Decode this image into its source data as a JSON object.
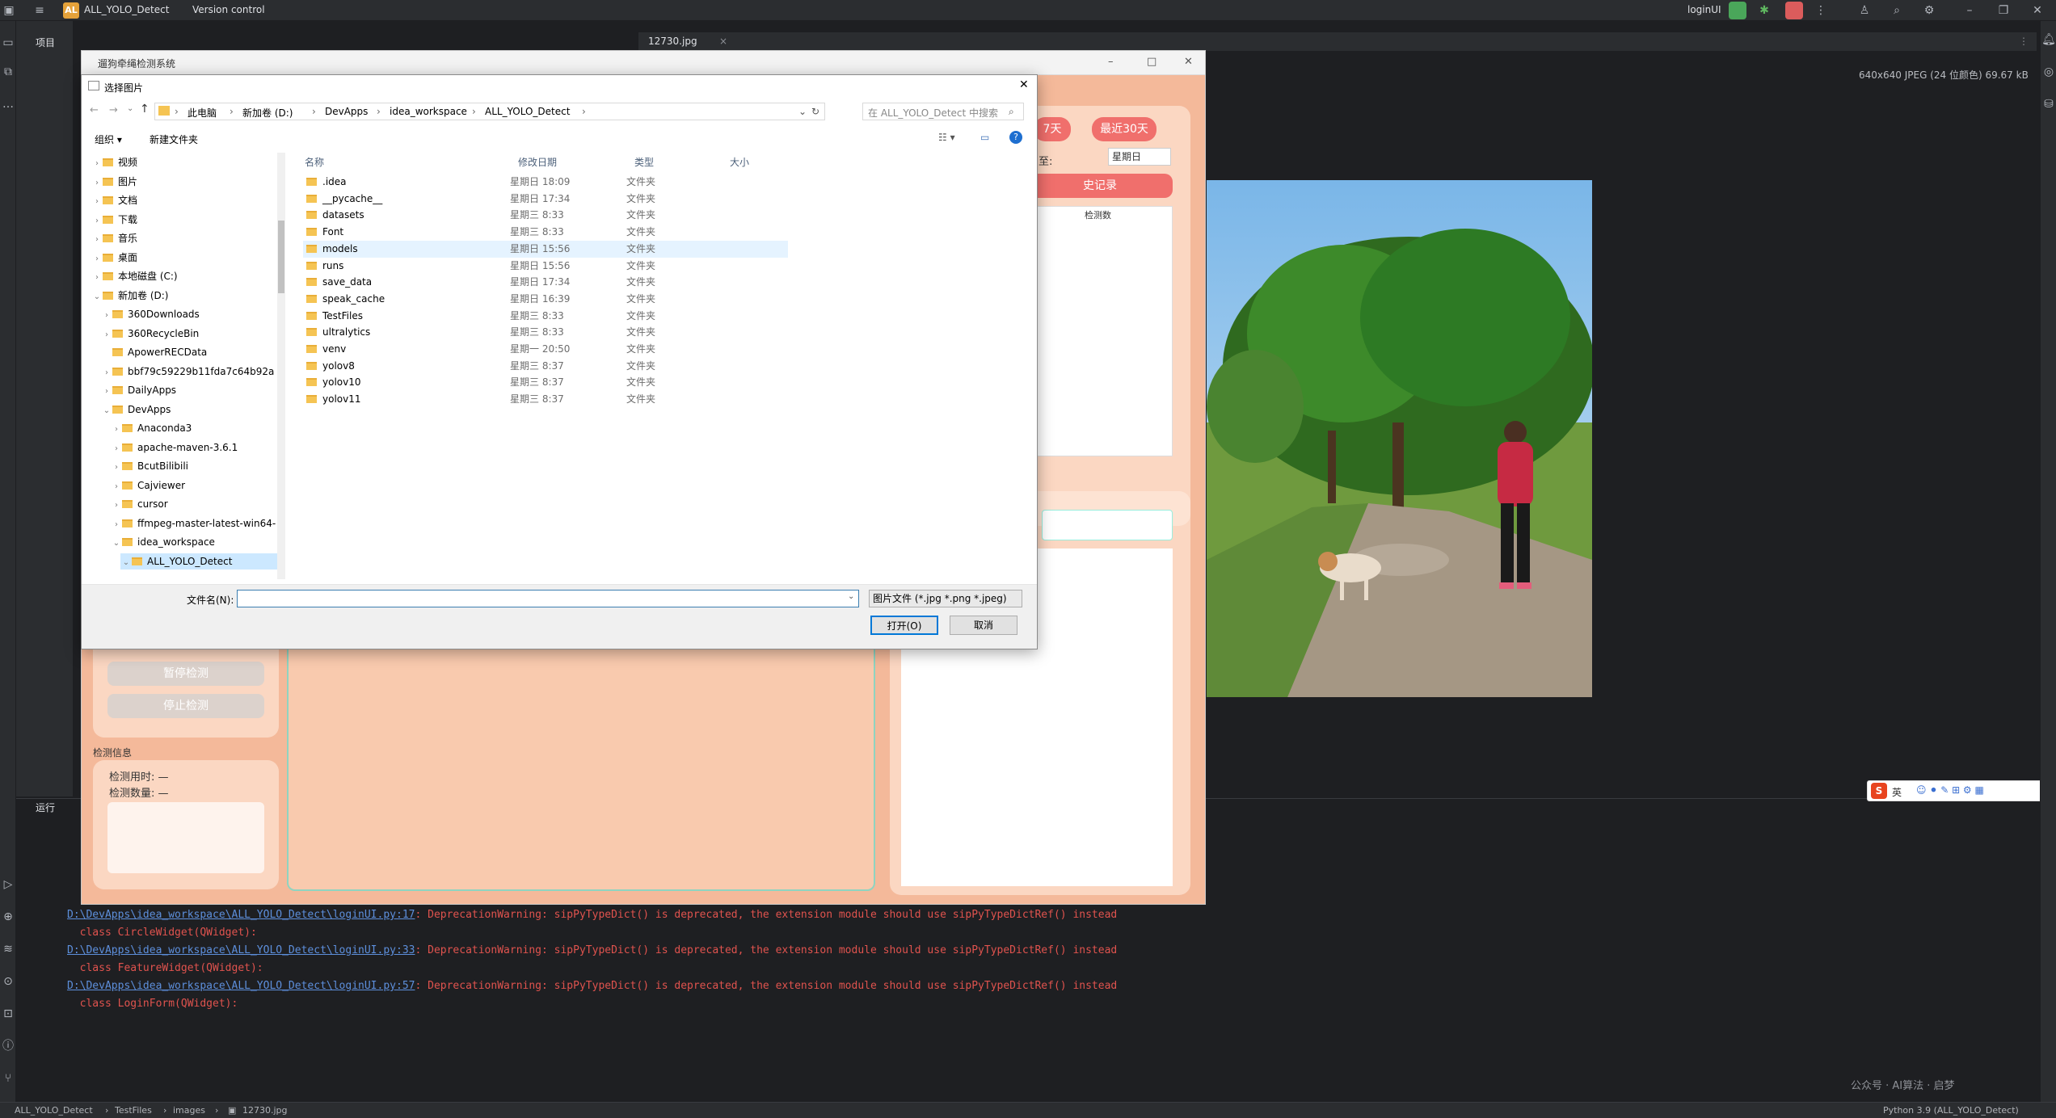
{
  "ide": {
    "project_name": "ALL_YOLO_Detect",
    "project_badge": "AL",
    "vcs": "Version control",
    "run_config": "loginUI",
    "project_tool": "项目",
    "editor_tab": "12730.jpg",
    "image_info": "640x640 JPEG (24 位颜色) 69.67 kB",
    "run_tool": "运行",
    "log": [
      {
        "link": "D:\\DevApps\\idea_workspace\\ALL_YOLO_Detect\\loginUI.py:17",
        "msg": ": DeprecationWarning: sipPyTypeDict() is deprecated, the extension module should use sipPyTypeDictRef() instead",
        "cls": "  class CircleWidget(QWidget):"
      },
      {
        "link": "D:\\DevApps\\idea_workspace\\ALL_YOLO_Detect\\loginUI.py:33",
        "msg": ": DeprecationWarning: sipPyTypeDict() is deprecated, the extension module should use sipPyTypeDictRef() instead",
        "cls": "  class FeatureWidget(QWidget):"
      },
      {
        "link": "D:\\DevApps\\idea_workspace\\ALL_YOLO_Detect\\loginUI.py:57",
        "msg": ": DeprecationWarning: sipPyTypeDict() is deprecated, the extension module should use sipPyTypeDictRef() instead",
        "cls": "  class LoginForm(QWidget):"
      }
    ],
    "breadcrumb": [
      "ALL_YOLO_Detect",
      "TestFiles",
      "images",
      "12730.jpg"
    ],
    "python": "Python 3.9 (ALL_YOLO_Detect)",
    "ime": "英",
    "watermark": "公众号 · AI算法 · 启梦"
  },
  "app": {
    "title": "遛狗牵绳检测系统",
    "btn_7days": "7天",
    "btn_30days": "最近30天",
    "to_label": "至:",
    "weekday": "星期日",
    "history": "史记录",
    "col_count": "检测数",
    "pause": "暂停检测",
    "stop": "停止检测",
    "info_title": "检测信息",
    "time_label": "检测用时: —",
    "count_label": "检测数量: —"
  },
  "dialog": {
    "title": "选择图片",
    "path": [
      "此电脑",
      "新加卷 (D:)",
      "DevApps",
      "idea_workspace",
      "ALL_YOLO_Detect"
    ],
    "search_placeholder": "在 ALL_YOLO_Detect 中搜索",
    "organize": "组织 ▾",
    "new_folder": "新建文件夹",
    "tree": [
      {
        "label": "视频",
        "level": 0,
        "arrow": "›"
      },
      {
        "label": "图片",
        "level": 0,
        "arrow": "›"
      },
      {
        "label": "文档",
        "level": 0,
        "arrow": "›"
      },
      {
        "label": "下载",
        "level": 0,
        "arrow": "›"
      },
      {
        "label": "音乐",
        "level": 0,
        "arrow": "›"
      },
      {
        "label": "桌面",
        "level": 0,
        "arrow": "›"
      },
      {
        "label": "本地磁盘 (C:)",
        "level": 0,
        "arrow": "›"
      },
      {
        "label": "新加卷 (D:)",
        "level": 0,
        "arrow": "⌄"
      },
      {
        "label": "360Downloads",
        "level": 1,
        "arrow": "›"
      },
      {
        "label": "360RecycleBin",
        "level": 1,
        "arrow": "›"
      },
      {
        "label": "ApowerRECData",
        "level": 1,
        "arrow": ""
      },
      {
        "label": "bbf79c59229b11fda7c64b92a",
        "level": 1,
        "arrow": "›"
      },
      {
        "label": "DailyApps",
        "level": 1,
        "arrow": "›"
      },
      {
        "label": "DevApps",
        "level": 1,
        "arrow": "⌄"
      },
      {
        "label": "Anaconda3",
        "level": 2,
        "arrow": "›"
      },
      {
        "label": "apache-maven-3.6.1",
        "level": 2,
        "arrow": "›"
      },
      {
        "label": "BcutBilibili",
        "level": 2,
        "arrow": "›"
      },
      {
        "label": "Cajviewer",
        "level": 2,
        "arrow": "›"
      },
      {
        "label": "cursor",
        "level": 2,
        "arrow": "›"
      },
      {
        "label": "ffmpeg-master-latest-win64-",
        "level": 2,
        "arrow": "›"
      },
      {
        "label": "idea_workspace",
        "level": 2,
        "arrow": "⌄"
      },
      {
        "label": "ALL_YOLO_Detect",
        "level": 3,
        "arrow": "⌄"
      }
    ],
    "columns": [
      "名称",
      "修改日期",
      "类型",
      "大小"
    ],
    "files": [
      {
        "name": ".idea",
        "date": "星期日 18:09",
        "type": "文件夹"
      },
      {
        "name": "__pycache__",
        "date": "星期日 17:34",
        "type": "文件夹"
      },
      {
        "name": "datasets",
        "date": "星期三 8:33",
        "type": "文件夹"
      },
      {
        "name": "Font",
        "date": "星期三 8:33",
        "type": "文件夹"
      },
      {
        "name": "models",
        "date": "星期日 15:56",
        "type": "文件夹"
      },
      {
        "name": "runs",
        "date": "星期日 15:56",
        "type": "文件夹"
      },
      {
        "name": "save_data",
        "date": "星期日 17:34",
        "type": "文件夹"
      },
      {
        "name": "speak_cache",
        "date": "星期日 16:39",
        "type": "文件夹"
      },
      {
        "name": "TestFiles",
        "date": "星期三 8:33",
        "type": "文件夹"
      },
      {
        "name": "ultralytics",
        "date": "星期三 8:33",
        "type": "文件夹"
      },
      {
        "name": "venv",
        "date": "星期一 20:50",
        "type": "文件夹"
      },
      {
        "name": "yolov8",
        "date": "星期三 8:37",
        "type": "文件夹"
      },
      {
        "name": "yolov10",
        "date": "星期三 8:37",
        "type": "文件夹"
      },
      {
        "name": "yolov11",
        "date": "星期三 8:37",
        "type": "文件夹"
      }
    ],
    "filename_label": "文件名(N):",
    "filename_value": "",
    "filetype": "图片文件 (*.jpg *.png *.jpeg)",
    "open": "打开(O)",
    "cancel": "取消"
  }
}
